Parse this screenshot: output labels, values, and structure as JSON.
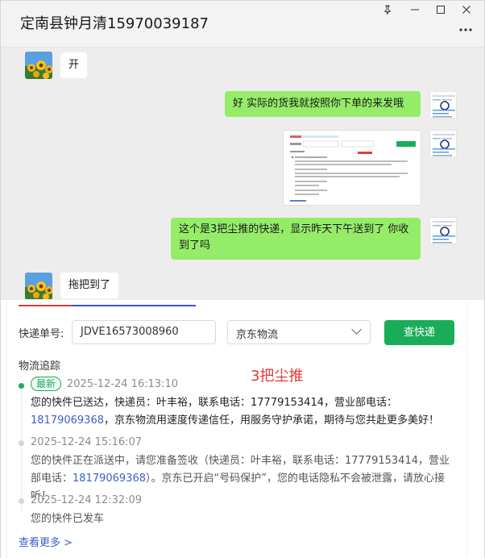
{
  "window": {
    "title": "定南县钟月清15970039187",
    "pin_icon": "pin-icon",
    "minimize_icon": "minimize-icon",
    "maximize_icon": "maximize-icon",
    "close_icon": "close-icon",
    "more_icon": "more-icon"
  },
  "messages": [
    {
      "side": "in",
      "text": "开"
    },
    {
      "side": "out",
      "text": "好 实际的货我就按照你下单的来发哦"
    },
    {
      "side": "out",
      "type": "image"
    },
    {
      "side": "out",
      "text": "这个是3把尘推的快递，显示昨天下午送到了 你收到了吗"
    },
    {
      "side": "in",
      "text": "拖把到了"
    }
  ],
  "tracking": {
    "label_no": "快递单号:",
    "tracking_number": "JDVE16573008960",
    "carrier": "京东物流",
    "query_button": "查快递",
    "section_title": "物流追踪",
    "annotation": "3把尘推",
    "badge_latest": "最新",
    "events": [
      {
        "time": "2025-12-24 16:13:10",
        "text_a": "您的快件已送达，快递员：叶丰裕，联系电话：17779153414，营业部电话：",
        "phone": "18179069368",
        "text_b": "，京东物流用速度传递信任，用服务守护承诺，期待与您共赴更多美好！"
      },
      {
        "time": "2025-12-24 15:16:07",
        "text_a": "您的快件正在派送中，请您准备签收（快递员：叶丰裕，联系电话：17779153414，营业部电话：",
        "phone": "18179069368",
        "text_b": "）。京东已开启“号码保护”，您的电话隐私不会被泄露，请放心接听！"
      },
      {
        "time": "2025-12-24 12:32:09",
        "text_a": "您的快件已发车",
        "phone": "",
        "text_b": ""
      }
    ],
    "more_link": "查看更多 >"
  },
  "colors": {
    "bubble_out": "#95ec69",
    "bubble_in": "#ffffff",
    "accent_green": "#19ad5a",
    "link_blue": "#3a5fcd",
    "annotation_red": "#e23b3b"
  }
}
